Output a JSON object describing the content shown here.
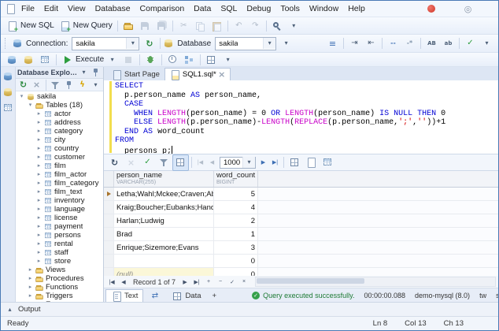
{
  "menu": {
    "items": [
      "File",
      "Edit",
      "View",
      "Database",
      "Comparison",
      "Data",
      "SQL",
      "Debug",
      "Tools",
      "Window",
      "Help"
    ]
  },
  "toolbar1": [
    {
      "name": "new-sql-button",
      "icon": "page-add",
      "label": "New SQL"
    },
    {
      "name": "new-query-button",
      "icon": "query-add",
      "label": "New Query"
    },
    {
      "sep": true
    },
    {
      "name": "open-file-button",
      "icon": "folder-open"
    },
    {
      "name": "save-button",
      "icon": "save",
      "disabled": true
    },
    {
      "name": "save-all-button",
      "icon": "save-all",
      "disabled": true
    },
    {
      "sep": true
    },
    {
      "name": "cut-button",
      "glyph": "cut",
      "disabled": true
    },
    {
      "name": "copy-button",
      "icon": "copy",
      "disabled": true
    },
    {
      "name": "paste-button",
      "icon": "paste",
      "disabled": true
    },
    {
      "sep": true
    },
    {
      "name": "undo-button",
      "glyph": "undo",
      "disabled": true
    },
    {
      "name": "redo-button",
      "glyph": "redo",
      "disabled": true
    },
    {
      "sep": true
    },
    {
      "name": "find-button",
      "icon": "find"
    },
    {
      "name": "toolbar-overflow-button",
      "glyph": "chevron"
    }
  ],
  "toolbar2": {
    "connection_label": "Connection:",
    "connection_value": "sakila",
    "database_label": "Database",
    "database_value": "sakila",
    "right_icons": [
      {
        "name": "format-sql-button",
        "glyph": "format"
      },
      {
        "sep": true
      },
      {
        "name": "indent-button",
        "glyph": "indent"
      },
      {
        "name": "outdent-button",
        "glyph": "outdent"
      },
      {
        "sep": true
      },
      {
        "name": "comment-button",
        "glyph": "comment"
      },
      {
        "name": "uncomment-button",
        "glyph": "uncomment"
      },
      {
        "sep": true
      },
      {
        "name": "uppercase-button",
        "glyph": "upper"
      },
      {
        "name": "lowercase-button",
        "glyph": "lower"
      },
      {
        "sep": true
      },
      {
        "name": "validate-button",
        "glyph": "check"
      },
      {
        "name": "toolbar-overflow-button",
        "glyph": "chevron"
      }
    ]
  },
  "toolbar3": [
    {
      "name": "new-connection-button",
      "icon": "db-add"
    },
    {
      "name": "new-database-button",
      "icon": "db-gold"
    },
    {
      "name": "table-designer-button",
      "icon": "table"
    },
    {
      "sep": true
    },
    {
      "name": "execute-button",
      "icon": "play",
      "label": "Execute",
      "dd": true
    },
    {
      "name": "stop-button",
      "icon": "stop",
      "disabled": true
    },
    {
      "sep": true
    },
    {
      "name": "debug-button",
      "icon": "bug"
    },
    {
      "sep": true
    },
    {
      "name": "query-profiler-button",
      "icon": "clock"
    },
    {
      "name": "explain-plan-button",
      "icon": "plan"
    },
    {
      "sep": true
    },
    {
      "name": "results-layout-button",
      "icon": "grid"
    },
    {
      "name": "toolbar-overflow-button",
      "glyph": "chevron"
    }
  ],
  "rail": [
    {
      "name": "rail-connections-button",
      "icon": "db"
    },
    {
      "name": "rail-database-button",
      "icon": "db-gold"
    },
    {
      "name": "rail-schema-button",
      "icon": "table"
    }
  ],
  "explorer": {
    "title": "Database Explorer ...",
    "toolbar": [
      {
        "name": "refresh-explorer-button",
        "glyph": "refresh"
      },
      {
        "name": "disconnect-button",
        "glyph": "close2"
      },
      {
        "sep": true
      },
      {
        "name": "filter-objects-button",
        "icon": "filter"
      },
      {
        "name": "pin-button",
        "icon": "pin"
      },
      {
        "name": "generate-script-button",
        "glyph": "bolt"
      },
      {
        "name": "explorer-overflow-button",
        "glyph": "chevron"
      }
    ],
    "tree": [
      {
        "label": "sakila",
        "icon": "db-gold",
        "level": 0,
        "exp": "open"
      },
      {
        "label": "Tables (18)",
        "icon": "folder",
        "level": 1,
        "exp": "open"
      },
      {
        "label": "actor",
        "icon": "table",
        "level": 2,
        "exp": "closed"
      },
      {
        "label": "address",
        "icon": "table",
        "level": 2,
        "exp": "closed"
      },
      {
        "label": "category",
        "icon": "table",
        "level": 2,
        "exp": "closed"
      },
      {
        "label": "city",
        "icon": "table",
        "level": 2,
        "exp": "closed"
      },
      {
        "label": "country",
        "icon": "table",
        "level": 2,
        "exp": "closed"
      },
      {
        "label": "customer",
        "icon": "table",
        "level": 2,
        "exp": "closed"
      },
      {
        "label": "film",
        "icon": "table",
        "level": 2,
        "exp": "closed"
      },
      {
        "label": "film_actor",
        "icon": "table",
        "level": 2,
        "exp": "closed"
      },
      {
        "label": "film_category",
        "icon": "table",
        "level": 2,
        "exp": "closed"
      },
      {
        "label": "film_text",
        "icon": "table",
        "level": 2,
        "exp": "closed"
      },
      {
        "label": "inventory",
        "icon": "table",
        "level": 2,
        "exp": "closed"
      },
      {
        "label": "language",
        "icon": "table",
        "level": 2,
        "exp": "closed"
      },
      {
        "label": "license",
        "icon": "table",
        "level": 2,
        "exp": "closed"
      },
      {
        "label": "payment",
        "icon": "table",
        "level": 2,
        "exp": "closed"
      },
      {
        "label": "persons",
        "icon": "table",
        "level": 2,
        "exp": "closed"
      },
      {
        "label": "rental",
        "icon": "table",
        "level": 2,
        "exp": "closed"
      },
      {
        "label": "staff",
        "icon": "table",
        "level": 2,
        "exp": "closed"
      },
      {
        "label": "store",
        "icon": "table",
        "level": 2,
        "exp": "closed"
      },
      {
        "label": "Views",
        "icon": "folder",
        "level": 1,
        "exp": "closed"
      },
      {
        "label": "Procedures",
        "icon": "folder",
        "level": 1,
        "exp": "closed"
      },
      {
        "label": "Functions",
        "icon": "folder",
        "level": 1,
        "exp": "closed"
      },
      {
        "label": "Triggers",
        "icon": "folder",
        "level": 1,
        "exp": "closed"
      },
      {
        "label": "Events",
        "icon": "folder",
        "level": 1,
        "exp": "closed"
      }
    ]
  },
  "tabs": [
    {
      "name": "tab-start-page",
      "icon": "home",
      "label": "Start Page"
    },
    {
      "name": "tab-sql1",
      "icon": "page-sql",
      "label": "SQL1.sql*",
      "active": true,
      "closable": true
    }
  ],
  "editor": {
    "lines": [
      [
        {
          "t": "SELECT",
          "c": "kw"
        }
      ],
      [
        {
          "t": "  p.person_name ",
          "c": "id"
        },
        {
          "t": "AS",
          "c": "kw"
        },
        {
          "t": " person_name,",
          "c": "id"
        }
      ],
      [
        {
          "t": "  ",
          "c": "id"
        },
        {
          "t": "CASE",
          "c": "kw"
        }
      ],
      [
        {
          "t": "    ",
          "c": "id"
        },
        {
          "t": "WHEN",
          "c": "kw"
        },
        {
          "t": " ",
          "c": "id"
        },
        {
          "t": "LENGTH",
          "c": "fn"
        },
        {
          "t": "(person_name) = 0 ",
          "c": "id"
        },
        {
          "t": "OR",
          "c": "kw"
        },
        {
          "t": " ",
          "c": "id"
        },
        {
          "t": "LENGTH",
          "c": "fn"
        },
        {
          "t": "(person_name) ",
          "c": "id"
        },
        {
          "t": "IS NULL THEN",
          "c": "kw"
        },
        {
          "t": " 0",
          "c": "id"
        }
      ],
      [
        {
          "t": "    ",
          "c": "id"
        },
        {
          "t": "ELSE",
          "c": "kw"
        },
        {
          "t": " ",
          "c": "id"
        },
        {
          "t": "LENGTH",
          "c": "fn"
        },
        {
          "t": "(p.person_name)-",
          "c": "id"
        },
        {
          "t": "LENGTH",
          "c": "fn"
        },
        {
          "t": "(",
          "c": "id"
        },
        {
          "t": "REPLACE",
          "c": "fn"
        },
        {
          "t": "(p.person_name,",
          "c": "id"
        },
        {
          "t": "';'",
          "c": "str"
        },
        {
          "t": ",",
          "c": "id"
        },
        {
          "t": "''",
          "c": "str"
        },
        {
          "t": "))+1",
          "c": "id"
        }
      ],
      [
        {
          "t": "  ",
          "c": "id"
        },
        {
          "t": "END",
          "c": "kw"
        },
        {
          "t": " ",
          "c": "id"
        },
        {
          "t": "AS",
          "c": "kw"
        },
        {
          "t": " word_count",
          "c": "id"
        }
      ],
      [
        {
          "t": "FROM",
          "c": "kw"
        }
      ],
      [
        {
          "t": "  persons p;",
          "c": "id"
        }
      ]
    ]
  },
  "results": {
    "toolbar": [
      {
        "name": "refresh-data-button",
        "glyph": "refresh-dark"
      },
      {
        "name": "cancel-refresh-button",
        "glyph": "close2",
        "disabled": true
      },
      {
        "name": "apply-changes-button",
        "glyph": "check"
      },
      {
        "name": "filter-data-button",
        "icon": "filter"
      },
      {
        "name": "grid-mode-button",
        "icon": "grid",
        "pressed": true
      },
      {
        "sep": true
      },
      {
        "name": "first-page-button",
        "text_btn": "|◀",
        "disabled": true
      },
      {
        "name": "prev-page-button",
        "text_btn": "◀",
        "disabled": true
      },
      {
        "combo": true,
        "name": "page-size-combo",
        "value": "1000",
        "width": 46
      },
      {
        "name": "next-page-button",
        "text_btn": "▶"
      },
      {
        "name": "last-page-button",
        "text_btn": "▶|"
      },
      {
        "sep": true
      },
      {
        "name": "grid-view-button",
        "icon": "grid"
      },
      {
        "name": "card-view-button",
        "icon": "page"
      },
      {
        "name": "pivot-view-button",
        "icon": "table"
      }
    ],
    "columns": [
      {
        "name": "person_name",
        "type": "VARCHAR(255)"
      },
      {
        "name": "word_count",
        "type": "BIGINT"
      }
    ],
    "rows": [
      {
        "person_name": "Letha;Wahl;Mckee;Craven;Abney",
        "word_count": "5",
        "current": true
      },
      {
        "person_name": "Kraig;Boucher;Eubanks;Hand",
        "word_count": "4"
      },
      {
        "person_name": "Harlan;Ludwig",
        "word_count": "2"
      },
      {
        "person_name": "Brad",
        "word_count": "1"
      },
      {
        "person_name": "Enrique;Sizemore;Evans",
        "word_count": "3"
      },
      {
        "person_name": "",
        "word_count": "0"
      },
      {
        "person_name": "(null)",
        "word_count": "0",
        "is_null": true
      }
    ],
    "nav": {
      "label": "Record 1 of 7",
      "buttons_left": [
        {
          "name": "first-record-button",
          "t": "|◀"
        },
        {
          "name": "prev-record-button",
          "t": "◀"
        }
      ],
      "buttons_right": [
        {
          "name": "next-record-button",
          "t": "▶"
        },
        {
          "name": "last-record-button",
          "t": "▶|"
        },
        {
          "name": "append-record-button",
          "t": "+"
        },
        {
          "name": "delete-record-button",
          "t": "−"
        },
        {
          "name": "post-edit-button",
          "t": "✓"
        },
        {
          "name": "cancel-edit-button",
          "t": "×"
        }
      ]
    }
  },
  "bottom_tabs": [
    {
      "name": "tab-text",
      "icon": "page-lines",
      "label": "Text",
      "active": true
    },
    {
      "name": "tab-swap",
      "glyph": "swap"
    },
    {
      "name": "tab-data",
      "icon": "grid",
      "label": "Data"
    },
    {
      "name": "tab-add",
      "label": "+"
    }
  ],
  "status_strip": {
    "message": "Query executed successfully.",
    "time": "00:00:00.088",
    "server": "demo-mysql (8.0)",
    "user": "tw",
    "database": "sakila"
  },
  "output": {
    "label": "Output"
  },
  "statusbar": {
    "ready": "Ready",
    "ln": "Ln 8",
    "col": "Col 13",
    "ch": "Ch 13"
  }
}
